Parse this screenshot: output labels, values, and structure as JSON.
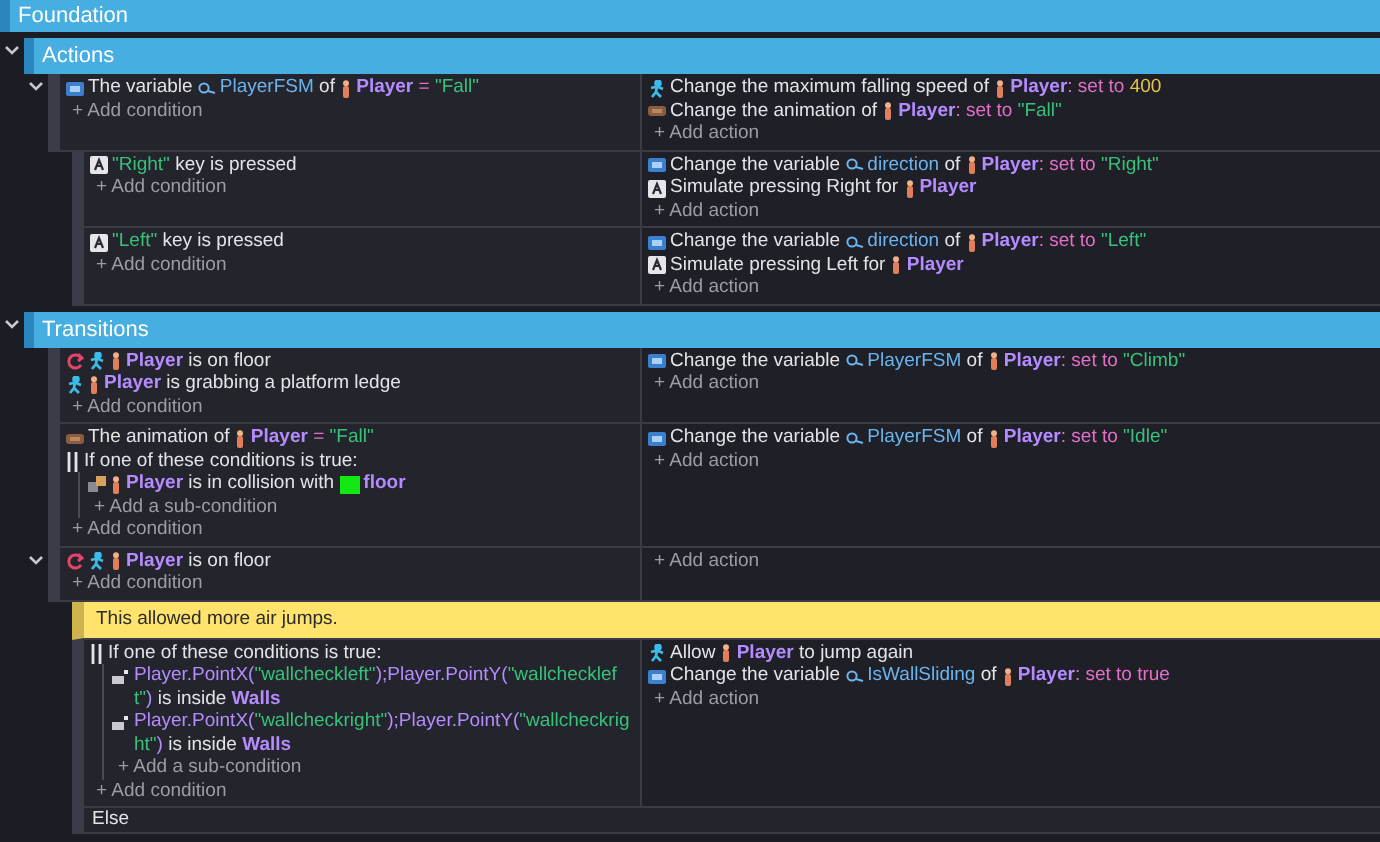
{
  "header": {
    "title": "Foundation"
  },
  "groups": [
    {
      "title": "Actions",
      "expanded": true,
      "events": [
        {
          "kind": "standard",
          "expanded": true,
          "conditions": [
            {
              "kind": "variable",
              "inverted": false,
              "parts": [
                {
                  "kind": "text",
                  "text": "The variable "
                },
                {
                  "kind": "variable",
                  "text": "PlayerFSM"
                },
                {
                  "kind": "text",
                  "text": " of "
                },
                {
                  "kind": "object",
                  "text": "Player"
                },
                {
                  "kind": "operator",
                  "text": " = "
                },
                {
                  "kind": "string",
                  "text": "\"Fall\""
                }
              ]
            }
          ],
          "add_condition": "+ Add condition",
          "actions": [
            {
              "kind": "platformer",
              "parts": [
                {
                  "kind": "text",
                  "text": "Change the maximum falling speed of "
                },
                {
                  "kind": "object",
                  "text": "Player"
                },
                {
                  "kind": "operator",
                  "text": ": set to "
                },
                {
                  "kind": "number",
                  "text": "400"
                }
              ]
            },
            {
              "kind": "animation",
              "parts": [
                {
                  "kind": "text",
                  "text": "Change the animation of "
                },
                {
                  "kind": "object",
                  "text": "Player"
                },
                {
                  "kind": "operator",
                  "text": ": set to "
                },
                {
                  "kind": "string",
                  "text": "\"Fall\""
                }
              ]
            }
          ],
          "add_action": "+ Add action",
          "children": [
            {
              "kind": "standard",
              "conditions": [
                {
                  "kind": "key",
                  "inverted": false,
                  "parts": [
                    {
                      "kind": "string",
                      "text": "\"Right\""
                    },
                    {
                      "kind": "text",
                      "text": " key is pressed"
                    }
                  ]
                }
              ],
              "add_condition": "+ Add condition",
              "actions": [
                {
                  "kind": "variable",
                  "parts": [
                    {
                      "kind": "text",
                      "text": "Change the variable "
                    },
                    {
                      "kind": "variable",
                      "text": "direction"
                    },
                    {
                      "kind": "text",
                      "text": " of "
                    },
                    {
                      "kind": "object",
                      "text": "Player"
                    },
                    {
                      "kind": "operator",
                      "text": ": set to "
                    },
                    {
                      "kind": "string",
                      "text": "\"Right\""
                    }
                  ]
                },
                {
                  "kind": "key",
                  "parts": [
                    {
                      "kind": "text",
                      "text": "Simulate pressing Right for "
                    },
                    {
                      "kind": "object",
                      "text": "Player"
                    }
                  ]
                }
              ],
              "add_action": "+ Add action"
            },
            {
              "kind": "standard",
              "conditions": [
                {
                  "kind": "key",
                  "inverted": false,
                  "parts": [
                    {
                      "kind": "string",
                      "text": "\"Left\""
                    },
                    {
                      "kind": "text",
                      "text": " key is pressed"
                    }
                  ]
                }
              ],
              "add_condition": "+ Add condition",
              "actions": [
                {
                  "kind": "variable",
                  "parts": [
                    {
                      "kind": "text",
                      "text": "Change the variable "
                    },
                    {
                      "kind": "variable",
                      "text": "direction"
                    },
                    {
                      "kind": "text",
                      "text": " of "
                    },
                    {
                      "kind": "object",
                      "text": "Player"
                    },
                    {
                      "kind": "operator",
                      "text": ": set to "
                    },
                    {
                      "kind": "string",
                      "text": "\"Left\""
                    }
                  ]
                },
                {
                  "kind": "key",
                  "parts": [
                    {
                      "kind": "text",
                      "text": "Simulate pressing Left for "
                    },
                    {
                      "kind": "object",
                      "text": "Player"
                    }
                  ]
                }
              ],
              "add_action": "+ Add action"
            }
          ]
        }
      ]
    },
    {
      "title": "Transitions",
      "expanded": true,
      "events": [
        {
          "kind": "standard",
          "conditions": [
            {
              "kind": "platformer",
              "inverted": true,
              "parts": [
                {
                  "kind": "object",
                  "text": "Player"
                },
                {
                  "kind": "text",
                  "text": " is on floor"
                }
              ]
            },
            {
              "kind": "platformer",
              "inverted": false,
              "parts": [
                {
                  "kind": "object",
                  "text": "Player"
                },
                {
                  "kind": "text",
                  "text": " is grabbing a platform ledge"
                }
              ]
            }
          ],
          "add_condition": "+ Add condition",
          "actions": [
            {
              "kind": "variable",
              "parts": [
                {
                  "kind": "text",
                  "text": "Change the variable "
                },
                {
                  "kind": "variable",
                  "text": "PlayerFSM"
                },
                {
                  "kind": "text",
                  "text": " of "
                },
                {
                  "kind": "object",
                  "text": "Player"
                },
                {
                  "kind": "operator",
                  "text": ": set to "
                },
                {
                  "kind": "string",
                  "text": "\"Climb\""
                }
              ]
            }
          ],
          "add_action": "+ Add action"
        },
        {
          "kind": "standard",
          "conditions": [
            {
              "kind": "animation",
              "inverted": false,
              "parts": [
                {
                  "kind": "text",
                  "text": "The animation of "
                },
                {
                  "kind": "object",
                  "text": "Player"
                },
                {
                  "kind": "operator",
                  "text": " = "
                },
                {
                  "kind": "string",
                  "text": "\"Fall\""
                }
              ]
            },
            {
              "kind": "or",
              "text": "If one of these conditions is true:",
              "sub_conditions": [
                {
                  "kind": "collision",
                  "inverted": false,
                  "parts": [
                    {
                      "kind": "object",
                      "text": "Player"
                    },
                    {
                      "kind": "text",
                      "text": " is in collision with "
                    },
                    {
                      "kind": "sprite",
                      "text": "floor"
                    }
                  ]
                }
              ],
              "add_sub_condition": "+ Add a sub-condition"
            }
          ],
          "add_condition": "+ Add condition",
          "actions": [
            {
              "kind": "variable",
              "parts": [
                {
                  "kind": "text",
                  "text": "Change the variable "
                },
                {
                  "kind": "variable",
                  "text": "PlayerFSM"
                },
                {
                  "kind": "text",
                  "text": " of "
                },
                {
                  "kind": "object",
                  "text": "Player"
                },
                {
                  "kind": "operator",
                  "text": ": set to "
                },
                {
                  "kind": "string",
                  "text": "\"Idle\""
                }
              ]
            }
          ],
          "add_action": "+ Add action"
        },
        {
          "kind": "standard",
          "expanded": true,
          "conditions": [
            {
              "kind": "platformer",
              "inverted": true,
              "parts": [
                {
                  "kind": "object",
                  "text": "Player"
                },
                {
                  "kind": "text",
                  "text": " is on floor"
                }
              ]
            }
          ],
          "add_condition": "+ Add condition",
          "add_action": "+ Add action",
          "children": [
            {
              "kind": "comment",
              "text": "This allowed more air jumps."
            },
            {
              "kind": "standard",
              "conditions": [
                {
                  "kind": "or",
                  "text": "If one of these conditions is true:",
                  "sub_conditions": [
                    {
                      "kind": "point",
                      "inverted": false,
                      "parts": [
                        {
                          "kind": "expression",
                          "text": "Player.PointX("
                        },
                        {
                          "kind": "string",
                          "text": "\"wallcheckleft\""
                        },
                        {
                          "kind": "expression",
                          "text": ");Player.PointY("
                        },
                        {
                          "kind": "string",
                          "text": "\"wallcheckleft\""
                        },
                        {
                          "kind": "expression",
                          "text": ")"
                        },
                        {
                          "kind": "text",
                          "text": " is inside "
                        },
                        {
                          "kind": "group",
                          "text": "Walls"
                        }
                      ]
                    },
                    {
                      "kind": "point",
                      "inverted": false,
                      "parts": [
                        {
                          "kind": "expression",
                          "text": "Player.PointX("
                        },
                        {
                          "kind": "string",
                          "text": "\"wallcheckright\""
                        },
                        {
                          "kind": "expression",
                          "text": ");Player.PointY("
                        },
                        {
                          "kind": "string",
                          "text": "\"wallcheckright\""
                        },
                        {
                          "kind": "expression",
                          "text": ")"
                        },
                        {
                          "kind": "text",
                          "text": " is inside "
                        },
                        {
                          "kind": "group",
                          "text": "Walls"
                        }
                      ]
                    }
                  ],
                  "add_sub_condition": "+ Add a sub-condition"
                }
              ],
              "add_condition": "+ Add condition",
              "actions": [
                {
                  "kind": "platformer",
                  "parts": [
                    {
                      "kind": "text",
                      "text": "Allow "
                    },
                    {
                      "kind": "object",
                      "text": "Player"
                    },
                    {
                      "kind": "text",
                      "text": " to jump again"
                    }
                  ]
                },
                {
                  "kind": "variable",
                  "parts": [
                    {
                      "kind": "text",
                      "text": "Change the variable "
                    },
                    {
                      "kind": "variable",
                      "text": "IsWallSliding"
                    },
                    {
                      "kind": "text",
                      "text": " of "
                    },
                    {
                      "kind": "object",
                      "text": "Player"
                    },
                    {
                      "kind": "operator",
                      "text": ": set to true"
                    }
                  ]
                }
              ],
              "add_action": "+ Add action"
            },
            {
              "kind": "else",
              "text": "Else"
            }
          ]
        }
      ]
    }
  ]
}
